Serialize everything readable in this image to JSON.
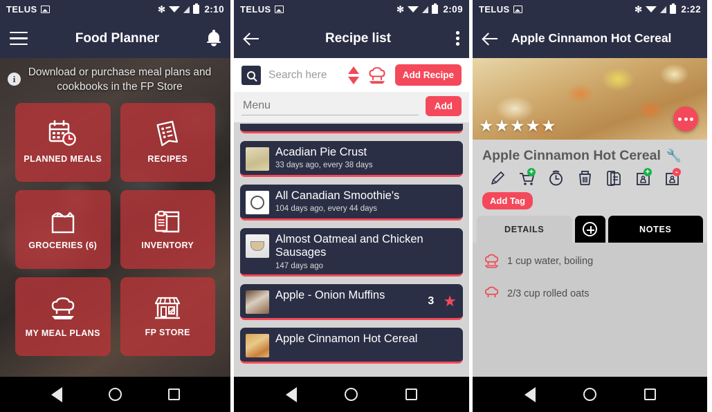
{
  "status_bar": {
    "carrier": "TELUS",
    "times": {
      "p1": "2:10",
      "p2": "2:09",
      "p3": "2:22"
    }
  },
  "colors": {
    "navy": "#2b2f45",
    "tile_red": "#b63438",
    "accent_red": "#f4495a",
    "bg_gray": "#d4d4d4"
  },
  "panel1": {
    "app_title": "Food Planner",
    "banner_text": "Download or purchase meal plans and cookbooks in the FP Store",
    "tiles": [
      {
        "label": "PLANNED MEALS",
        "icon": "calendar-clock-icon"
      },
      {
        "label": "RECIPES",
        "icon": "recipe-card-icon"
      },
      {
        "label": "GROCERIES (6)",
        "icon": "grocery-bag-icon"
      },
      {
        "label": "INVENTORY",
        "icon": "inventory-box-icon"
      },
      {
        "label": "MY MEAL PLANS",
        "icon": "chef-hat-icon"
      },
      {
        "label": "FP STORE",
        "icon": "storefront-icon"
      }
    ]
  },
  "panel2": {
    "app_title": "Recipe list",
    "search_placeholder": "Search here",
    "add_recipe_label": "Add Recipe",
    "menu_placeholder": "Menu",
    "menu_value": "",
    "add_label": "Add",
    "recipes": [
      {
        "title": "Acadian Pie Crust",
        "sub": "33 days ago, every 38 days",
        "thumb": "th-pie",
        "count": "",
        "star": false
      },
      {
        "title": "All Canadian Smoothie's",
        "sub": "104 days ago, every 44 days",
        "thumb": "th-plate",
        "count": "",
        "star": false
      },
      {
        "title": "Almost Oatmeal and Chicken Sausages",
        "sub": "147 days ago",
        "thumb": "th-cup",
        "count": "",
        "star": false
      },
      {
        "title": "Apple - Onion Muffins",
        "sub": "",
        "thumb": "th-muff",
        "count": "3",
        "star": true
      },
      {
        "title": "Apple Cinnamon Hot Cereal",
        "sub": "",
        "thumb": "th-cer",
        "count": "",
        "star": false
      }
    ]
  },
  "panel3": {
    "app_title": "Apple Cinnamon Hot Cereal",
    "recipe_title": "Apple Cinnamon Hot Cereal",
    "rating_stars": "★★★★★",
    "rating_value": 5,
    "add_tag_label": "Add Tag",
    "actions": [
      {
        "name": "edit-icon",
        "badge": ""
      },
      {
        "name": "add-to-cart-icon",
        "badge": "+"
      },
      {
        "name": "timer-icon",
        "badge": ""
      },
      {
        "name": "delete-icon",
        "badge": ""
      },
      {
        "name": "copy-icon",
        "badge": ""
      },
      {
        "name": "add-to-inventory-icon",
        "badge": "+"
      },
      {
        "name": "remove-from-inventory-icon",
        "badge": "-"
      }
    ],
    "tabs": [
      {
        "label": "DETAILS",
        "active": true
      },
      {
        "label": "NOTES",
        "active": false
      }
    ],
    "ingredients": [
      "1 cup water, boiling",
      "2/3 cup rolled oats"
    ]
  }
}
